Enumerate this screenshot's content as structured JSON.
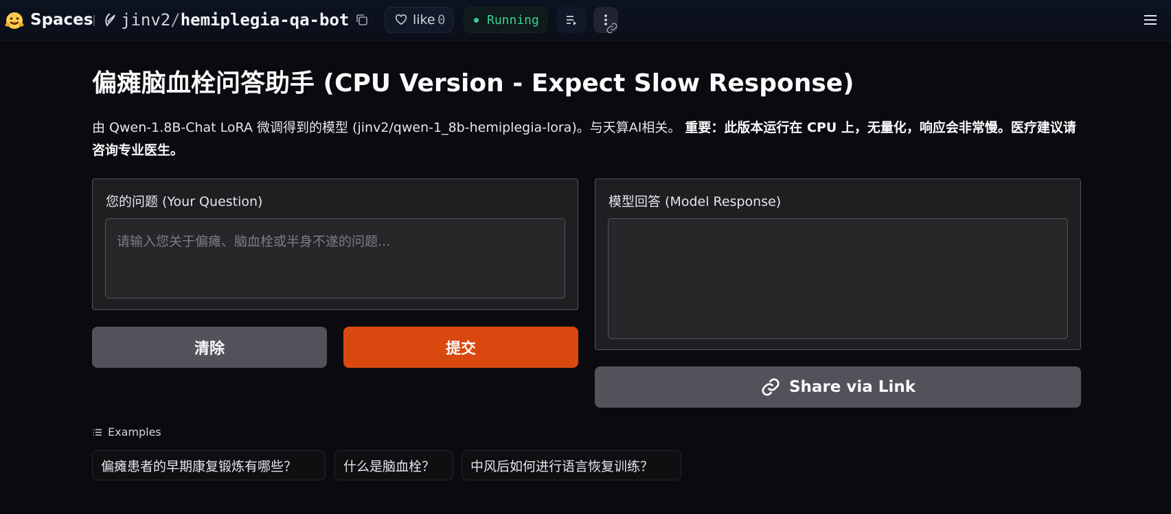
{
  "topbar": {
    "brand": "Spaces",
    "owner": "jinv2",
    "slash": "/",
    "repo_name": "hemiplegia-qa-bot",
    "like_label": "like",
    "like_count": "0",
    "status": "Running",
    "icons": [
      "hugging-face-logo",
      "owner-avatar-icon",
      "copy-icon",
      "heart-icon",
      "logs-icon",
      "more-vertical-icon",
      "link-icon",
      "hamburger-menu-icon"
    ],
    "status_color": "#34d399"
  },
  "main": {
    "title": "偏瘫脑血栓问答助手 (CPU Version - Expect Slow Response)",
    "description_line": "由 Qwen-1.8B-Chat LoRA 微调得到的模型 (jinv2/qwen-1_8b-hemiplegia-lora)。与天算AI相关。",
    "description_bold": "重要：此版本运行在 CPU 上，无量化，响应会非常慢。医疗建议请咨询专业医生。",
    "input_panel": {
      "label": "您的问题 (Your Question)",
      "placeholder": "请输入您关于偏瘫、脑血栓或半身不遂的问题...",
      "value": ""
    },
    "output_panel": {
      "label": "模型回答 (Model Response)",
      "value": ""
    },
    "buttons": {
      "clear": "清除",
      "submit": "提交",
      "share": "Share via Link"
    },
    "examples": {
      "heading": "Examples",
      "items": [
        "偏瘫患者的早期康复锻炼有哪些？",
        "什么是脑血栓？",
        "中风后如何进行语言恢复训练？"
      ]
    },
    "colors": {
      "submit": "#d9480f",
      "secondary": "#52525b"
    }
  }
}
